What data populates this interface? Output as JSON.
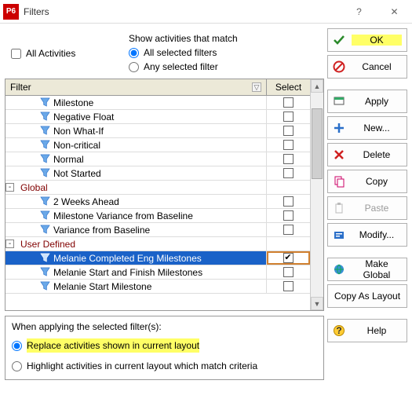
{
  "window": {
    "app_badge": "P6",
    "title": "Filters"
  },
  "top": {
    "all_activities_label": "All Activities",
    "all_activities_checked": false,
    "match_header": "Show activities that match",
    "opt_all": "All selected filters",
    "opt_any": "Any selected filter",
    "match_selected": "all"
  },
  "grid": {
    "col_filter": "Filter",
    "col_select": "Select",
    "rows": [
      {
        "type": "item",
        "indent": 2,
        "icon": "funnel",
        "label": "Milestone",
        "checked": false
      },
      {
        "type": "item",
        "indent": 2,
        "icon": "funnel",
        "label": "Negative Float",
        "checked": false
      },
      {
        "type": "item",
        "indent": 2,
        "icon": "funnel",
        "label": "Non What-If",
        "checked": false
      },
      {
        "type": "item",
        "indent": 2,
        "icon": "funnel",
        "label": "Non-critical",
        "checked": false
      },
      {
        "type": "item",
        "indent": 2,
        "icon": "funnel",
        "label": "Normal",
        "checked": false
      },
      {
        "type": "item",
        "indent": 2,
        "icon": "funnel",
        "label": "Not Started",
        "checked": false
      },
      {
        "type": "group",
        "indent": 0,
        "exp": "-",
        "label": "Global"
      },
      {
        "type": "item",
        "indent": 2,
        "icon": "funnel",
        "label": "2 Weeks Ahead",
        "checked": false
      },
      {
        "type": "item",
        "indent": 2,
        "icon": "funnel",
        "label": "Milestone Variance from Baseline",
        "checked": false
      },
      {
        "type": "item",
        "indent": 2,
        "icon": "funnel",
        "label": "Variance from Baseline",
        "checked": false
      },
      {
        "type": "group",
        "indent": 0,
        "exp": "-",
        "label": "User Defined"
      },
      {
        "type": "item",
        "indent": 2,
        "icon": "funnel",
        "label": "Melanie Completed Eng Milestones",
        "checked": true,
        "selected": true
      },
      {
        "type": "item",
        "indent": 2,
        "icon": "funnel",
        "label": "Melanie Start and Finish Milestones",
        "checked": false
      },
      {
        "type": "item",
        "indent": 2,
        "icon": "funnel",
        "label": "Melanie Start Milestone",
        "checked": false
      }
    ]
  },
  "apply_panel": {
    "header": "When applying the selected filter(s):",
    "opt_replace": "Replace activities shown in current layout",
    "opt_highlight": "Highlight activities in current layout which match criteria",
    "selected": "replace"
  },
  "buttons": {
    "ok": "OK",
    "cancel": "Cancel",
    "apply": "Apply",
    "new": "New...",
    "delete": "Delete",
    "copy": "Copy",
    "paste": "Paste",
    "modify": "Modify...",
    "make_global": "Make Global",
    "copy_as_layout": "Copy As Layout",
    "help": "Help"
  }
}
